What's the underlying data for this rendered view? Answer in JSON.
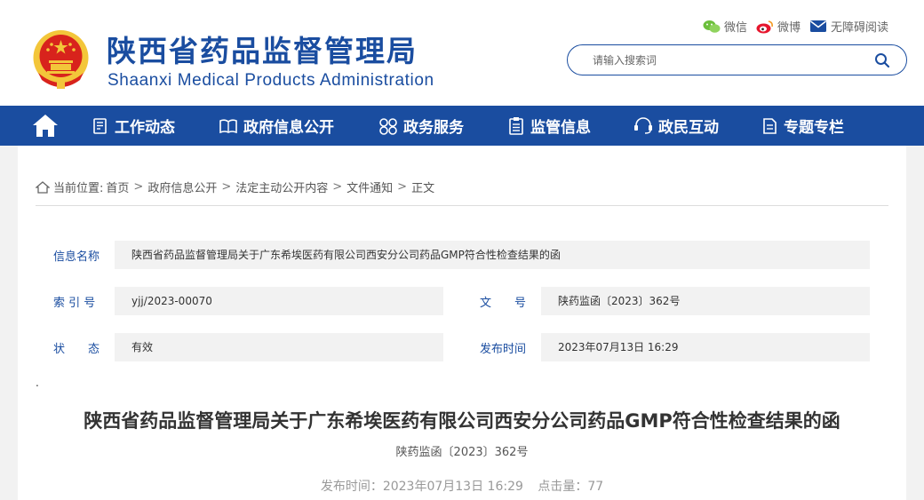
{
  "header": {
    "title": "陕西省药品监督管理局",
    "subtitle": "Shaanxi Medical Products Administration",
    "links": {
      "wechat": "微信",
      "weibo": "微博",
      "accessibility": "无障碍阅读"
    },
    "search_placeholder": "请输入搜索词",
    "colors": {
      "brand": "#1a4da0",
      "emblem_red": "#d8231c",
      "emblem_gold": "#f3c63a"
    }
  },
  "nav": {
    "items": [
      {
        "label": "工作动态",
        "icon": "news-icon"
      },
      {
        "label": "政府信息公开",
        "icon": "book-icon"
      },
      {
        "label": "政务服务",
        "icon": "services-icon"
      },
      {
        "label": "监管信息",
        "icon": "clipboard-icon"
      },
      {
        "label": "政民互动",
        "icon": "interaction-icon"
      },
      {
        "label": "专题专栏",
        "icon": "topics-icon"
      }
    ]
  },
  "breadcrumb": {
    "prefix": "当前位置:",
    "items": [
      "首页",
      "政府信息公开",
      "法定主动公开内容",
      "文件通知",
      "正文"
    ],
    "separator": ">"
  },
  "meta": {
    "name_label": "信息名称",
    "name_value": "陕西省药品监督管理局关于广东希埃医药有限公司西安分公司药品GMP符合性检查结果的函",
    "index_label": "索 引 号",
    "index_value": "yjj/2023-00070",
    "docno_label": "文　　号",
    "docno_value": "陕药监函〔2023〕362号",
    "status_label": "状　　态",
    "status_value": "有效",
    "date_label": "发布时间",
    "date_value": "2023年07月13日 16:29"
  },
  "article": {
    "dot": ".",
    "title": "陕西省药品监督管理局关于广东希埃医药有限公司西安分公司药品GMP符合性检查结果的函",
    "doc_number": "陕药监函〔2023〕362号",
    "publish_label": "发布时间：",
    "publish_time": "2023年07月13日 16:29",
    "views_label": "点击量：",
    "views": "77"
  }
}
